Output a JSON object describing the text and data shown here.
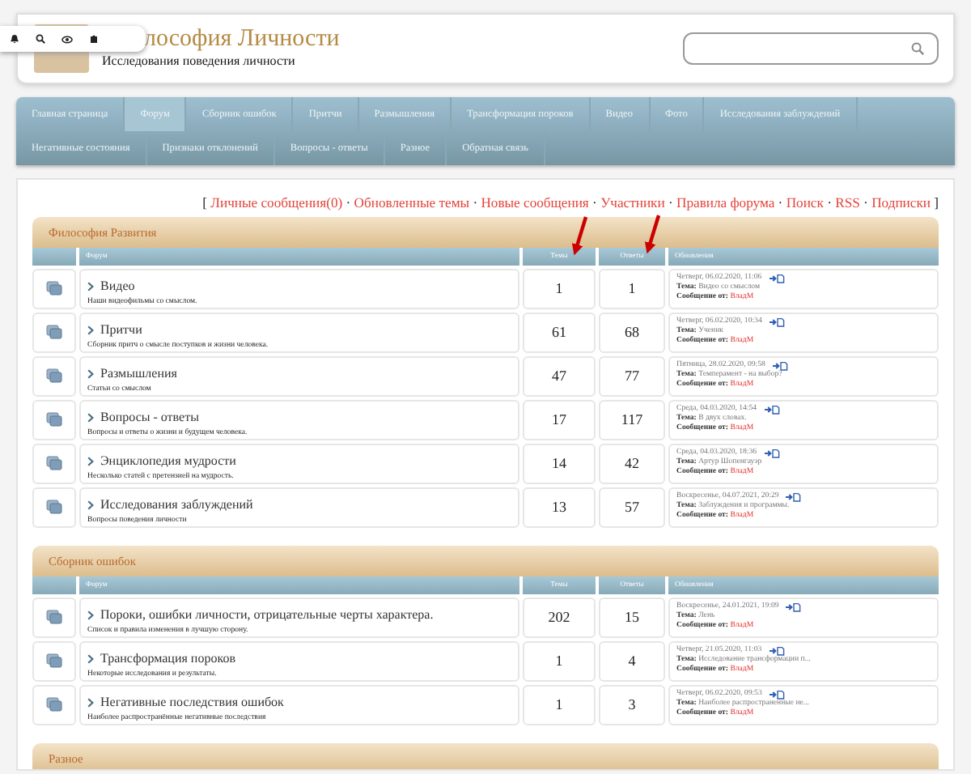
{
  "header": {
    "title": "лософия Личности",
    "subtitle": "Исследования поведения личности"
  },
  "nav": {
    "items": [
      {
        "label": "Главная страница",
        "selected": false
      },
      {
        "label": "Форум",
        "selected": true
      },
      {
        "label": "Сборник ошибок",
        "selected": false
      },
      {
        "label": "Притчи",
        "selected": false
      },
      {
        "label": "Размышления",
        "selected": false
      },
      {
        "label": "Трансформация пороков",
        "selected": false
      },
      {
        "label": "Видео",
        "selected": false
      },
      {
        "label": "Фото",
        "selected": false
      },
      {
        "label": "Исследования заблуждений",
        "selected": false
      },
      {
        "label": "Негативные состояния",
        "selected": false
      },
      {
        "label": "Признаки отклонений",
        "selected": false
      },
      {
        "label": "Вопросы - ответы",
        "selected": false
      },
      {
        "label": "Разное",
        "selected": false
      },
      {
        "label": "Обратная связь",
        "selected": false
      }
    ]
  },
  "quick_links": {
    "open": "[",
    "close": "]",
    "separator": "·",
    "links": [
      "Личные сообщения(0)",
      "Обновленные темы",
      "Новые сообщения",
      "Участники",
      "Правила форума",
      "Поиск",
      "RSS",
      "Подписки"
    ]
  },
  "categories": [
    {
      "title": "Философия Развития",
      "columns": [
        "Форум",
        "Темы",
        "Ответы",
        "Обновления"
      ],
      "forums": [
        {
          "name": "Видео",
          "description": "Наши видеофильмы со смыслом.",
          "topics": "1",
          "replies": "1",
          "last_post": {
            "date": "Четверг, 06.02.2020, 11:06",
            "topic_label": "Тема:",
            "topic": "Видео со смыслом",
            "author_label": "Сообщение от:",
            "author": "ВладМ"
          }
        },
        {
          "name": "Притчи",
          "description": "Сборник притч о смысле поступков и жизни человека.",
          "topics": "61",
          "replies": "68",
          "last_post": {
            "date": "Четверг, 06.02.2020, 10:34",
            "topic_label": "Тема:",
            "topic": "Ученик",
            "author_label": "Сообщение от:",
            "author": "ВладМ"
          }
        },
        {
          "name": "Размышления",
          "description": "Статьи со смыслом",
          "topics": "47",
          "replies": "77",
          "last_post": {
            "date": "Пятница, 28.02.2020, 09:58",
            "topic_label": "Тема:",
            "topic": "Темперамент - на выбор?",
            "author_label": "Сообщение от:",
            "author": "ВладМ"
          }
        },
        {
          "name": "Вопросы - ответы",
          "description": "Вопросы и ответы о жизни и будущем человека.",
          "topics": "17",
          "replies": "117",
          "last_post": {
            "date": "Среда, 04.03.2020, 14:54",
            "topic_label": "Тема:",
            "topic": "В двух словах.",
            "author_label": "Сообщение от:",
            "author": "ВладМ"
          }
        },
        {
          "name": "Энциклопедия мудрости",
          "description": "Несколько статей с претензией на мудрость.",
          "topics": "14",
          "replies": "42",
          "last_post": {
            "date": "Среда, 04.03.2020, 18:36",
            "topic_label": "Тема:",
            "topic": "Артур Шопенгауэр",
            "author_label": "Сообщение от:",
            "author": "ВладМ"
          }
        },
        {
          "name": "Исследования заблуждений",
          "description": "Вопросы поведения личности",
          "topics": "13",
          "replies": "57",
          "last_post": {
            "date": "Воскресенье, 04.07.2021, 20:29",
            "topic_label": "Тема:",
            "topic": "Заблуждения и программы.",
            "author_label": "Сообщение от:",
            "author": "ВладМ"
          }
        }
      ]
    },
    {
      "title": "Сборник ошибок",
      "columns": [
        "Форум",
        "Темы",
        "Ответы",
        "Обновления"
      ],
      "forums": [
        {
          "name": "Пороки, ошибки личности, отрицательные черты характера.",
          "description": "Список и правила изменения в лучшую сторону.",
          "topics": "202",
          "replies": "15",
          "last_post": {
            "date": "Воскресенье, 24.01.2021, 19:09",
            "topic_label": "Тема:",
            "topic": "Лень",
            "author_label": "Сообщение от:",
            "author": "ВладМ"
          }
        },
        {
          "name": "Трансформация пороков",
          "description": "Некоторые исследования и результаты.",
          "topics": "1",
          "replies": "4",
          "last_post": {
            "date": "Четверг, 21.05.2020, 11:03",
            "topic_label": "Тема:",
            "topic": "Исследование трансформации п...",
            "author_label": "Сообщение от:",
            "author": "ВладМ"
          }
        },
        {
          "name": "Негативные последствия ошибок",
          "description": "Наиболее распространённые негативные последствия",
          "topics": "1",
          "replies": "3",
          "last_post": {
            "date": "Четверг, 06.02.2020, 09:53",
            "topic_label": "Тема:",
            "topic": "Наиболее распространенные не...",
            "author_label": "Сообщение от:",
            "author": "ВладМ"
          }
        }
      ]
    },
    {
      "title": "Разное"
    }
  ]
}
